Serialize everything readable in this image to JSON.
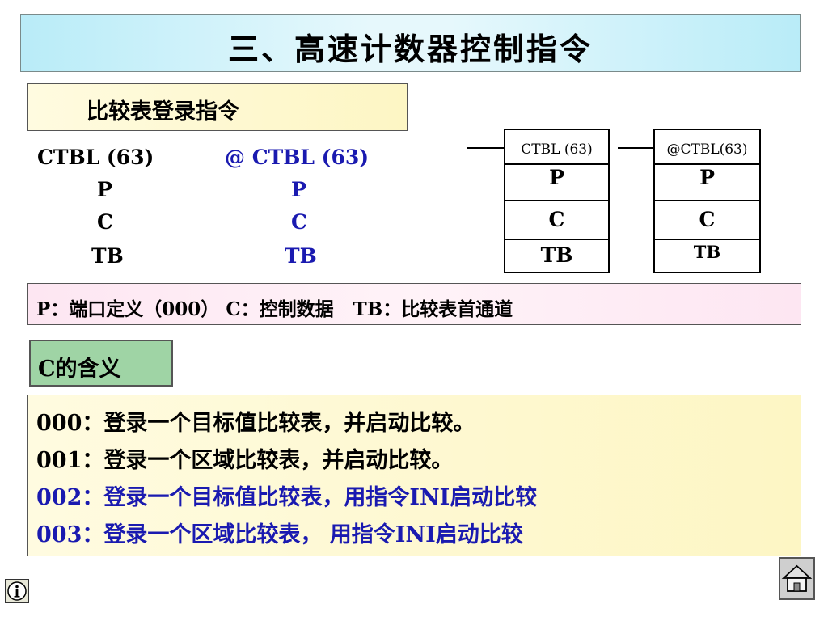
{
  "title": "三、高速计数器控制指令",
  "section1": {
    "label": "比较表登录指令"
  },
  "syntax": {
    "left": {
      "line1": "CTBL (63)",
      "line2": "P",
      "line3": "C",
      "line4": "TB"
    },
    "right": {
      "line1": "@ CTBL (63)",
      "line2": "P",
      "line3": "C",
      "line4": "TB"
    }
  },
  "ladder": {
    "block1": {
      "header": "CTBL (63)",
      "p": "P",
      "c": "C",
      "tb": "TB"
    },
    "block2": {
      "header": "@CTBL(63)",
      "p": "P",
      "c": "C",
      "tb": "TB"
    }
  },
  "definition": "P：端口定义（000） C：控制数据   TB：比较表首通道",
  "section2": {
    "label": "C的含义"
  },
  "meanings": [
    {
      "text": "000：登录一个目标值比较表，并启动比较。",
      "color": "#000000"
    },
    {
      "text": "001：登录一个区域比较表，并启动比较。",
      "color": "#000000"
    },
    {
      "text": "002：登录一个目标值比较表，用指令INI启动比较",
      "color": "#1a1ab0"
    },
    {
      "text": "003：登录一个区域比较表， 用指令INI启动比较",
      "color": "#1a1ab0"
    }
  ],
  "icons": {
    "info": "info-icon",
    "home": "home-icon"
  }
}
